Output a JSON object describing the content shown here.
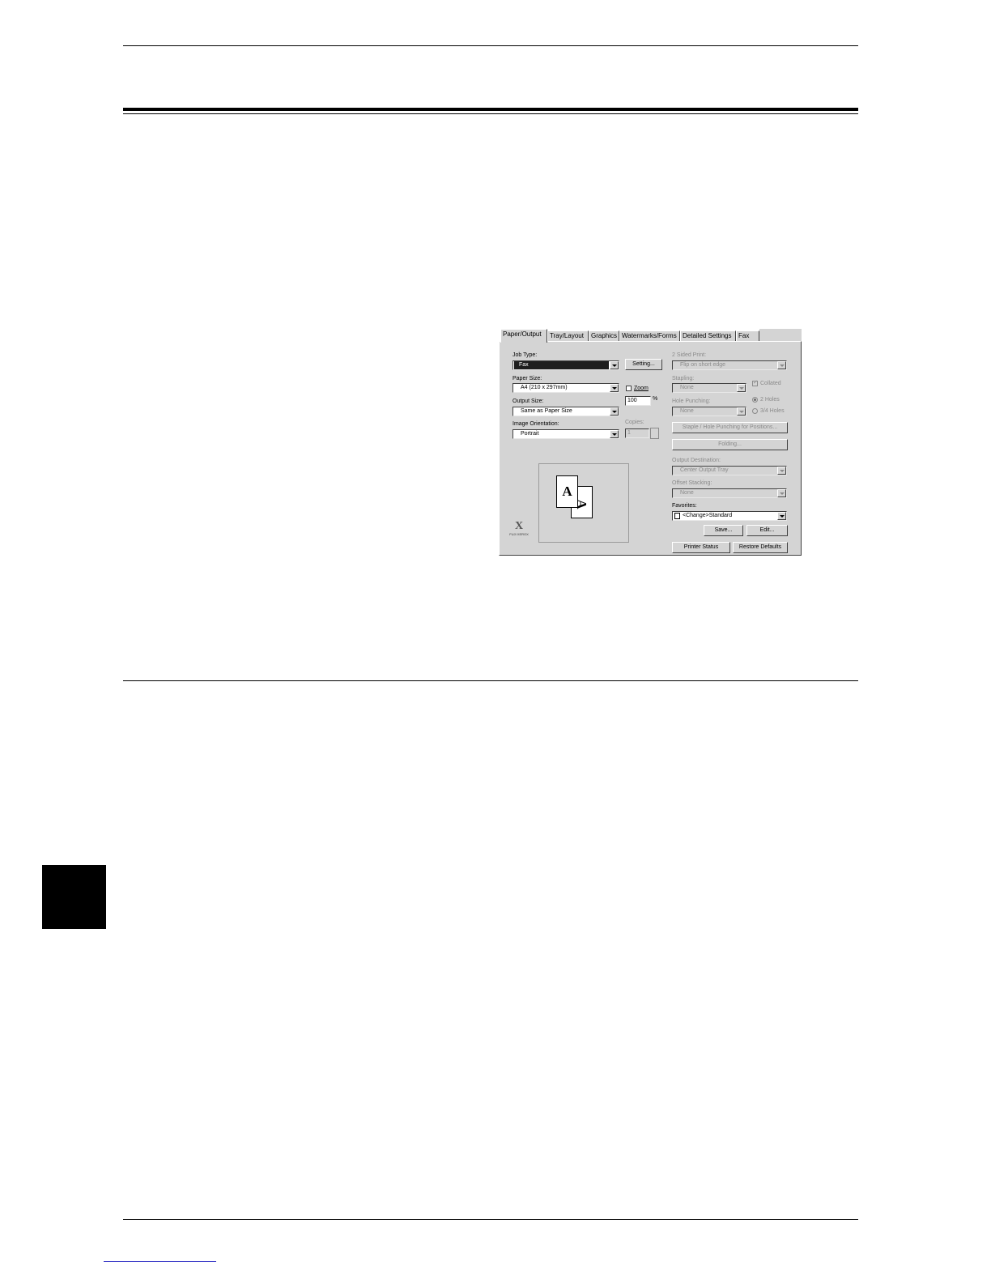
{
  "dialog": {
    "tabs": [
      "Paper/Output",
      "Tray/Layout",
      "Graphics",
      "Watermarks/Forms",
      "Detailed Settings",
      "Fax"
    ],
    "job_type": {
      "label": "Job Type:",
      "value": "Fax",
      "setting_button": "Setting..."
    },
    "paper_size": {
      "label": "Paper Size:",
      "value": "A4 (210 x 297mm)"
    },
    "zoom": {
      "label": "Zoom",
      "value": "100",
      "unit": "%"
    },
    "output_size": {
      "label": "Output Size:",
      "value": "Same as Paper Size"
    },
    "image_orientation": {
      "label": "Image Orientation:",
      "value": "Portrait"
    },
    "copies": {
      "label": "Copies:",
      "value": "1"
    },
    "two_sided": {
      "label": "2 Sided Print:",
      "value": "Flip on short edge"
    },
    "stapling": {
      "label": "Stapling:",
      "value": "None"
    },
    "collated": {
      "label": "Collated"
    },
    "hole_punching": {
      "label": "Hole Punching:",
      "value": "None"
    },
    "holes": [
      "2 Holes",
      "3/4 Holes"
    ],
    "staple_position_button": "Staple / Hole Punching for Positions...",
    "folding_button": "Folding...",
    "output_destination": {
      "label": "Output Destination:",
      "value": "Center Output Tray"
    },
    "offset_stacking": {
      "label": "Offset Stacking:",
      "value": "None"
    },
    "favorites": {
      "label": "Favorites:",
      "value": "<Change>Standard",
      "save_button": "Save...",
      "edit_button": "Edit..."
    },
    "printer_status_button": "Printer Status",
    "restore_defaults_button": "Restore Defaults",
    "preview": {
      "front_letter": "A",
      "back_letter": "A"
    },
    "logo": {
      "mark": "X",
      "name": "FUJI XEROX"
    }
  }
}
